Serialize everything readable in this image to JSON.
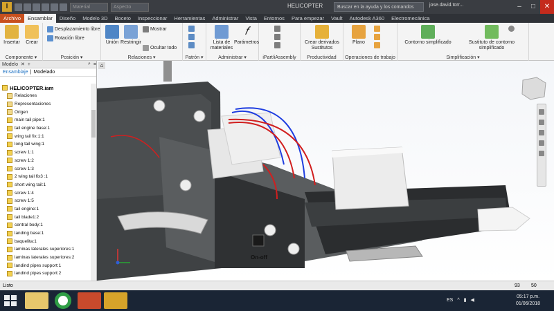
{
  "titlebar": {
    "logo": "I",
    "combo1": "Material",
    "combo2": "Aspecto",
    "title": "HELICOPTER",
    "search_text": "Buscar en la ayuda y los comandos",
    "user": "jose.david.torr...",
    "min": "–",
    "max": "□",
    "close": "✕"
  },
  "tabs": [
    "Archivo",
    "Ensamblar",
    "Diseño",
    "Modelo 3D",
    "Boceto",
    "Inspeccionar",
    "Herramientas",
    "Administrar",
    "Vista",
    "Entornos",
    "Para empezar",
    "Vault",
    "Autodesk A360",
    "Electromecánica"
  ],
  "ribbon": {
    "componente": {
      "label": "Componente ▾",
      "insertar": "Insertar",
      "crear": "Crear"
    },
    "posicion": {
      "label": "Posición ▾",
      "desplazamiento": "Desplazamiento libre",
      "rotacion": "Rotación libre"
    },
    "relaciones": {
      "label": "Relaciones ▾",
      "union": "Unión",
      "restringir": "Restringir",
      "mostrar": "Mostrar",
      "ocultar": "Ocultar todo"
    },
    "patron": {
      "label": "Patrón ▾"
    },
    "administrar": {
      "label": "Administrar ▾",
      "lista": "Lista de materiales",
      "parametros": "Parámetros"
    },
    "ipart": {
      "label": "iPart/iAssembly"
    },
    "productividad": {
      "label": "Productividad",
      "crear_derivados": "Crear derivados Sustitutos"
    },
    "operaciones": {
      "label": "Operaciones de trabajo",
      "plano": "Plano"
    },
    "simplificacion": {
      "label": "Simplificación ▾",
      "contorno": "Contorno simplificado",
      "sustituto": "Sustituto de contorno simplificado"
    }
  },
  "browser": {
    "header": "Modelo",
    "add": "+",
    "close": "✕",
    "search": "⌕",
    "menu": "≡",
    "tab_ensamblaje": "Ensamblaje",
    "tab_modelado": "Modelado",
    "root": "HELICOPTER.iam",
    "items": [
      "Relaciones",
      "Representaciones",
      "Origen",
      "main tail pipe:1",
      "tail engine base:1",
      "wing tail fix:1:1",
      "long tail wing:1",
      "screw 1:1",
      "screw 1:2",
      "screw 1:3",
      "2 wing tail fix3 :1",
      "short wing tail:1",
      "screw 1:4",
      "screw 1:5",
      "tail engine:1",
      "tail blade1:2",
      "central body:1",
      "landing base:1",
      "baquelita:1",
      "laminas laterales superiores:1",
      "laminas laterales superiores:2",
      "landind pipes support:1",
      "landind pipes support:2"
    ]
  },
  "viewport": {
    "switch_label": "On-off"
  },
  "statusbar": {
    "text": "Listo",
    "n1": "93",
    "n2": "50"
  },
  "taskbar": {
    "lang": "ES",
    "time": "05:17 p.m.",
    "date": "01/06/2018"
  }
}
